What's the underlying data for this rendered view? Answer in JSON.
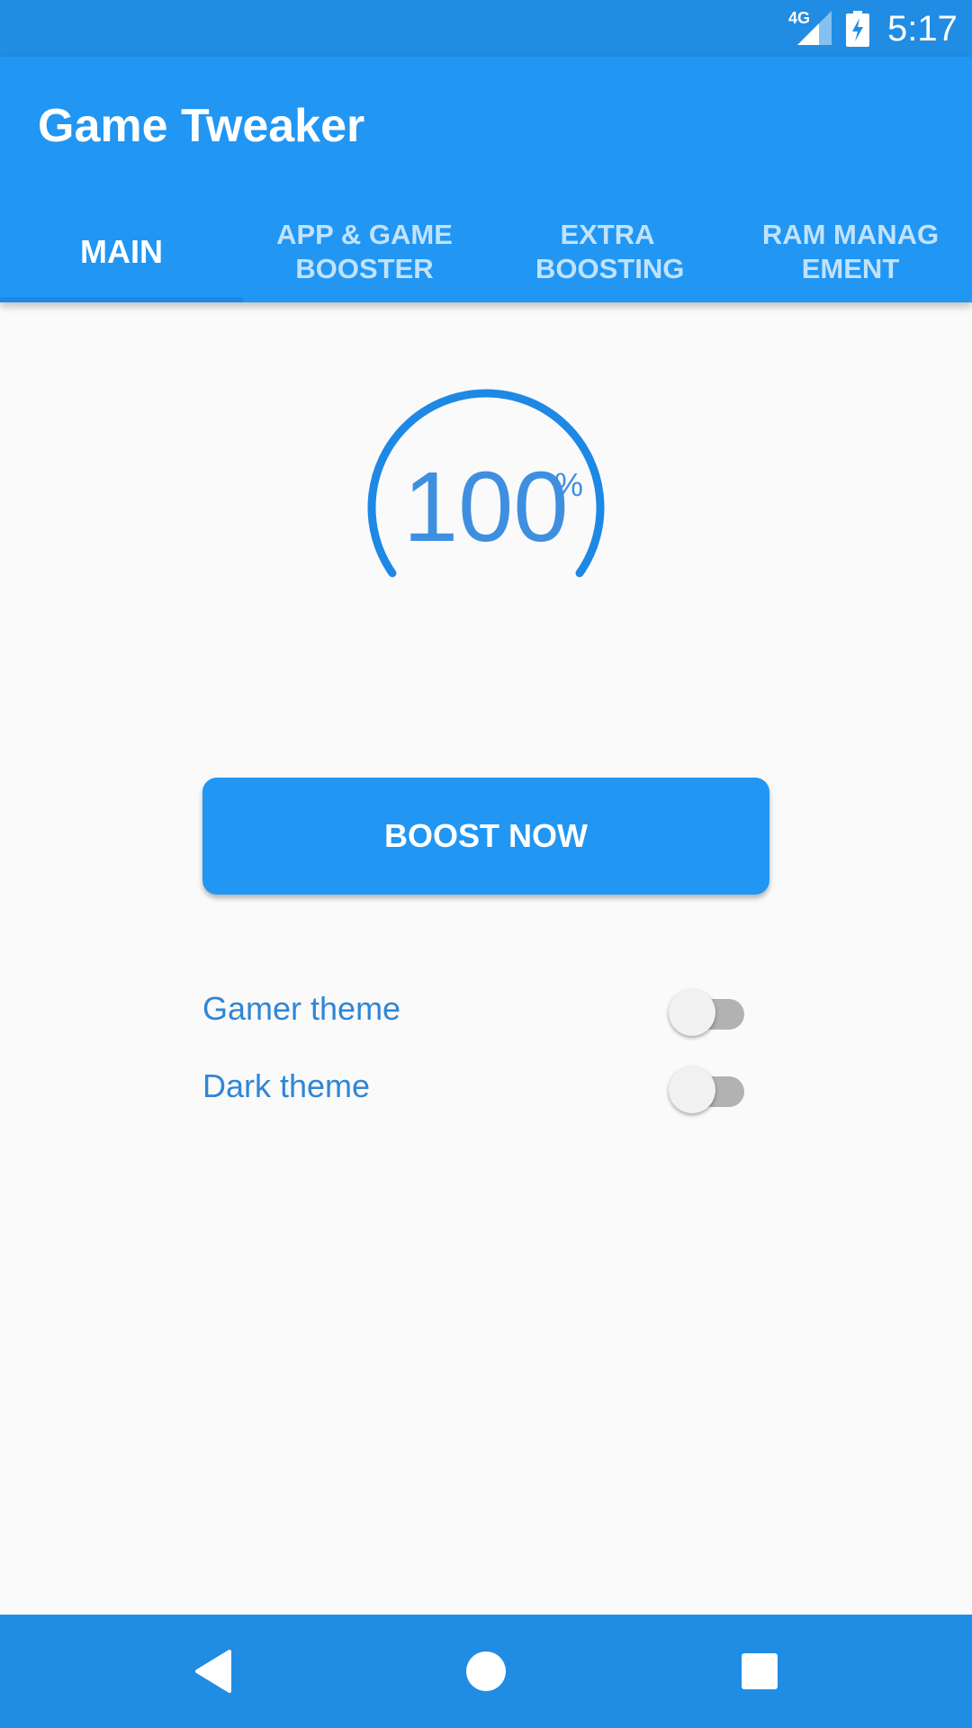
{
  "status_bar": {
    "network": "4G",
    "time": "5:17",
    "icons": [
      "signal-icon",
      "battery-charging-icon"
    ]
  },
  "app_bar": {
    "title": "Game Tweaker",
    "tabs": [
      {
        "label": "MAIN",
        "active": true
      },
      {
        "label": "APP & GAME BOOSTER",
        "active": false
      },
      {
        "label": "EXTRA BOOSTING",
        "active": false
      },
      {
        "label": "RAM MANAG EMENT",
        "active": false
      }
    ]
  },
  "gauge": {
    "value": "100",
    "unit": "%",
    "level_percent": 100
  },
  "boost_button": {
    "label": "BOOST NOW"
  },
  "settings": [
    {
      "label": "Gamer theme",
      "enabled": false
    },
    {
      "label": "Dark theme",
      "enabled": false
    }
  ],
  "navigation_bar": {
    "icons": [
      "back-icon",
      "home-icon",
      "recents-icon"
    ]
  },
  "colors": {
    "primary": "#2196F3",
    "status_bar": "#218CE3",
    "gauge_arc": "#1E88E5",
    "accent_text": "#2F86D6",
    "background": "#FAFAFA"
  }
}
